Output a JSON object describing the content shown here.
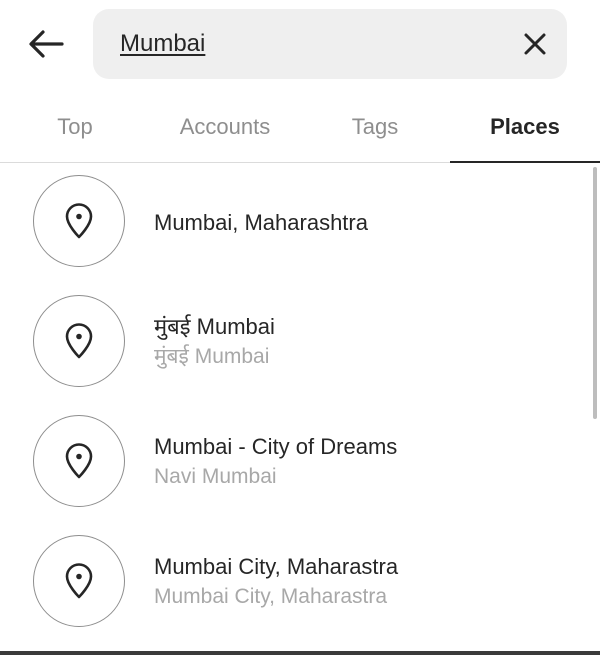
{
  "search": {
    "value": "Mumbai",
    "back_icon": "arrow-left-icon",
    "clear_icon": "close-icon"
  },
  "tabs": [
    {
      "label": "Top",
      "active": false
    },
    {
      "label": "Accounts",
      "active": false
    },
    {
      "label": "Tags",
      "active": false
    },
    {
      "label": "Places",
      "active": true
    }
  ],
  "results": [
    {
      "title": "Mumbai, Maharashtra",
      "subtitle": "",
      "icon": "location-pin-icon"
    },
    {
      "title": "मुंबई  Mumbai",
      "subtitle": "मुंबई  Mumbai",
      "icon": "location-pin-icon"
    },
    {
      "title": "Mumbai - City of Dreams",
      "subtitle": "Navi Mumbai",
      "icon": "location-pin-icon"
    },
    {
      "title": "Mumbai City, Maharastra",
      "subtitle": "Mumbai City, Maharastra",
      "icon": "location-pin-icon"
    }
  ],
  "colors": {
    "text_primary": "#262626",
    "text_secondary": "#a8a8a8",
    "tab_inactive": "#8e8e8e",
    "search_bg": "#efefef"
  }
}
